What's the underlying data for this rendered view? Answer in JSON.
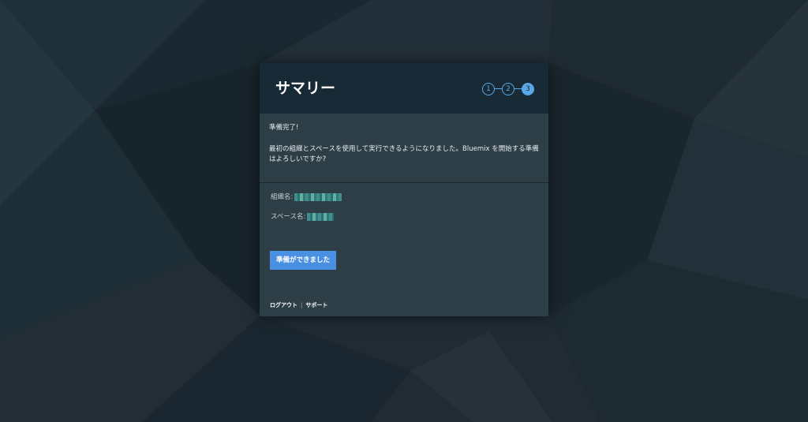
{
  "background": {
    "base_color": "#1c262f",
    "style": "dark low-poly geometric"
  },
  "card": {
    "title": "サマリー",
    "steps": [
      {
        "label": "1",
        "active": false
      },
      {
        "label": "2",
        "active": false
      },
      {
        "label": "3",
        "active": true
      }
    ],
    "intro_line1": "準備完了!",
    "intro_line2": "最初の組織とスペースを使用して実行できるようになりました。Bluemix を開始する準備はよろしいですか?",
    "org_label": "組織名:",
    "space_label": "スペース名:",
    "ready_button": "準備ができました",
    "footer": {
      "logout": "ログアウト",
      "separator": "|",
      "support": "サポート"
    }
  },
  "colors": {
    "header_bg": "#182a35",
    "card_bg": "#2d3e47",
    "accent": "#5aa7e8",
    "button_bg": "#4a90e2"
  }
}
